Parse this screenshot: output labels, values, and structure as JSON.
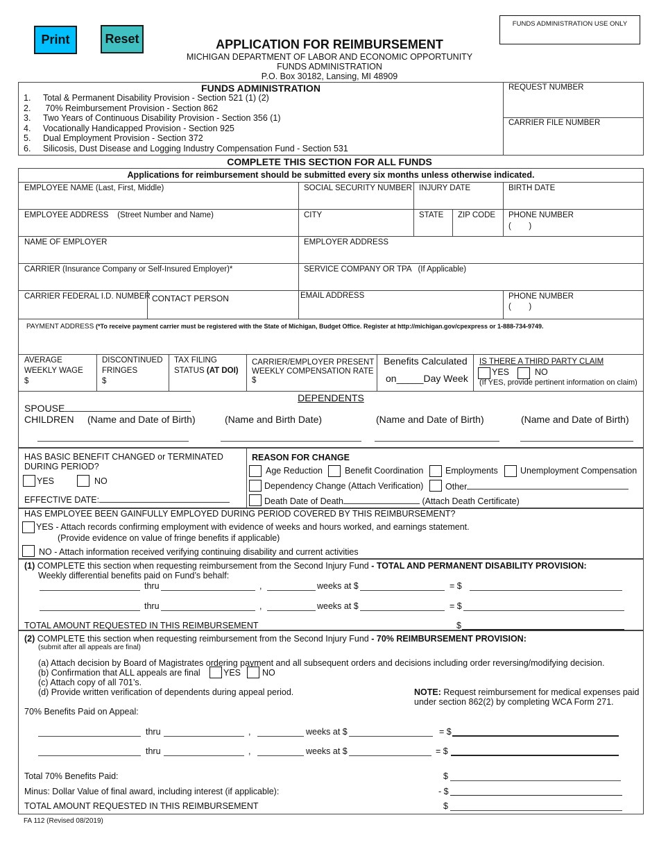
{
  "buttons": {
    "print": "Print",
    "reset": "Reset"
  },
  "header": {
    "title": "APPLICATION FOR REIMBURSEMENT",
    "lines": [
      "MICHIGAN DEPARTMENT OF LABOR AND ECONOMIC OPPORTUNITY",
      "FUNDS ADMINISTRATION",
      "P.O. Box 30182, Lansing, MI 48909"
    ],
    "use_only": "FUNDS ADMINISTRATION USE ONLY"
  },
  "funds": {
    "heading": "FUNDS ADMINISTRATION",
    "items": [
      {
        "num": "1.",
        "text": "Total & Permanent Disability Provision - Section 521 (1) (2)"
      },
      {
        "num": "2.",
        "text": " 70% Reimbursement Provision - Section 862"
      },
      {
        "num": "3.",
        "text": "Two Years of Continuous Disability Provision - Section 356 (1)"
      },
      {
        "num": "4.",
        "text": "Vocationally Handicapped Provision - Section 925"
      },
      {
        "num": "5.",
        "text": "Dual Employment Provision - Section 372"
      },
      {
        "num": "6.",
        "text": "Silicosis, Dust Disease and Logging Industry Compensation Fund - Section 531"
      }
    ],
    "request_number": "REQUEST NUMBER",
    "carrier_file_number": "CARRIER FILE NUMBER"
  },
  "all_funds": {
    "heading": "COMPLETE THIS SECTION FOR ALL FUNDS",
    "notice": "Applications for reimbursement should be submitted every six months unless otherwise indicated."
  },
  "fields": {
    "employee_name": "EMPLOYEE NAME  (Last, First, Middle)",
    "ssn": "SOCIAL SECURITY NUMBER",
    "injury_date": "INJURY DATE",
    "birth_date": "BIRTH DATE",
    "employee_address": "EMPLOYEE ADDRESS    (Street Number and Name)",
    "city": "CITY",
    "state": "STATE",
    "zip": "ZIP CODE",
    "phone": "PHONE NUMBER",
    "phone_paren": "(        )",
    "employer_name": "NAME OF EMPLOYER",
    "employer_address": "EMPLOYER ADDRESS",
    "carrier": "CARRIER (Insurance Company or Self-Insured Employer)*",
    "service_company": "SERVICE COMPANY OR TPA   (If Applicable)",
    "carrier_fein": "CARRIER FEDERAL I.D. NUMBER",
    "contact_person": "CONTACT PERSON",
    "email": "EMAIL ADDRESS",
    "phone2": "PHONE NUMBER",
    "payment_address": "PAYMENT ADDRESS ",
    "payment_note": "(*To receive payment carrier must be registered with the State of Michigan, Budget Office.  Register at http://michigan.gov/cpexpress or 1-888-734-9749."
  },
  "wages": {
    "aww_line1": "AVERAGE",
    "aww_line2": "WEEKLY WAGE",
    "dollar": "$",
    "fringes_line1": "DISCONTINUED",
    "fringes_line2": "FRINGES",
    "tax_line1": "TAX FILING",
    "tax_line2": "STATUS ",
    "tax_bold": "(AT DOI)",
    "rate_line1": "CARRIER/EMPLOYER PRESENT",
    "rate_line2": "WEEKLY COMPENSATION RATE",
    "benefits_calc": "Benefits Calculated",
    "benefits_on": "on_____Day Week",
    "third_party": "IS THERE A THIRD PARTY CLAIM",
    "yes": "YES",
    "no": "NO",
    "third_party_note": "(If YES, provide pertinent information on claim)"
  },
  "dependents": {
    "heading": "DEPENDENTS",
    "spouse": "SPOUSE",
    "children": "CHILDREN",
    "columns": [
      "(Name and Date of Birth)",
      "(Name and Birth Date)",
      "(Name and Date of Birth)",
      "(Name and Date of Birth)"
    ]
  },
  "benefit_change": {
    "question_line1": "HAS BASIC BENEFIT CHANGED or TERMINATED",
    "question_line2": "DURING PERIOD?",
    "yes": "YES",
    "no": "NO",
    "effective_date": "EFFECTIVE DATE:",
    "reason_heading": "REASON FOR CHANGE",
    "age_reduction": "Age Reduction",
    "benefit_coordination": "Benefit Coordination",
    "employments": "Employments",
    "unemployment": "Unemployment Compensation",
    "dependency_change": "Dependency Change (Attach Verification)",
    "other": "Other",
    "death": "Death  Date of Death",
    "death_cert": "(Attach Death Certificate)"
  },
  "employment": {
    "question": "HAS EMPLOYEE BEEN GAINFULLY EMPLOYED DURING PERIOD COVERED BY THIS REIMBURSEMENT?",
    "yes_text": "YES - Attach records confirming employment with evidence of weeks and hours worked, and earnings statement.",
    "yes_sub": "(Provide evidence on value of fringe benefits if applicable)",
    "no_text": "NO  - Attach information received verifying continuing disability and current activities"
  },
  "section1": {
    "num": "(1)",
    "intro": " COMPLETE this section when requesting reimbursement from the Second Injury Fund ",
    "bold": "- TOTAL AND PERMANENT DISABILITY PROVISION:",
    "sub": "Weekly differential benefits paid on Fund’s behalf:",
    "thru": "thru",
    "comma": ",",
    "weeks_at": "weeks at $",
    "equals": "= $",
    "total": "TOTAL AMOUNT REQUESTED IN THIS REIMBURSEMENT",
    "dollar": "$"
  },
  "section2": {
    "num": "(2)",
    "intro": " COMPLETE this section when requesting reimbursement from the Second Injury Fund ",
    "bold": "- 70% REIMBURSEMENT PROVISION:",
    "sub": "(submit after all appeals are final)",
    "a": "(a) Attach decision by Board of Magistrates ordering payment and all subsequent orders and decisions including order reversing/modifying decision.",
    "b": "(b) Confirmation that ALL appeals are final",
    "yes": "YES",
    "no": "NO",
    "c": "(c) Attach copy of all 701’s.",
    "d": "(d) Provide written verification of dependents during appeal period.",
    "note_bold": "NOTE:",
    "note_line1": " Request reimbursement for medical expenses paid",
    "note_line2": "under section 862(2) by completing WCA Form 271.",
    "paid_on_appeal": "70% Benefits Paid on Appeal:",
    "thru": "thru",
    "comma": ",",
    "weeks_at": "weeks at $",
    "equals": "= $",
    "total_paid": "Total 70% Benefits Paid:",
    "minus": "Minus: Dollar Value of final award, including interest (if applicable):",
    "total": "TOTAL AMOUNT REQUESTED IN THIS REIMBURSEMENT",
    "dollar": "$",
    "minus_dollar": "- $"
  },
  "footer": {
    "form_id": "FA 112 (Revised 08/2019)"
  }
}
